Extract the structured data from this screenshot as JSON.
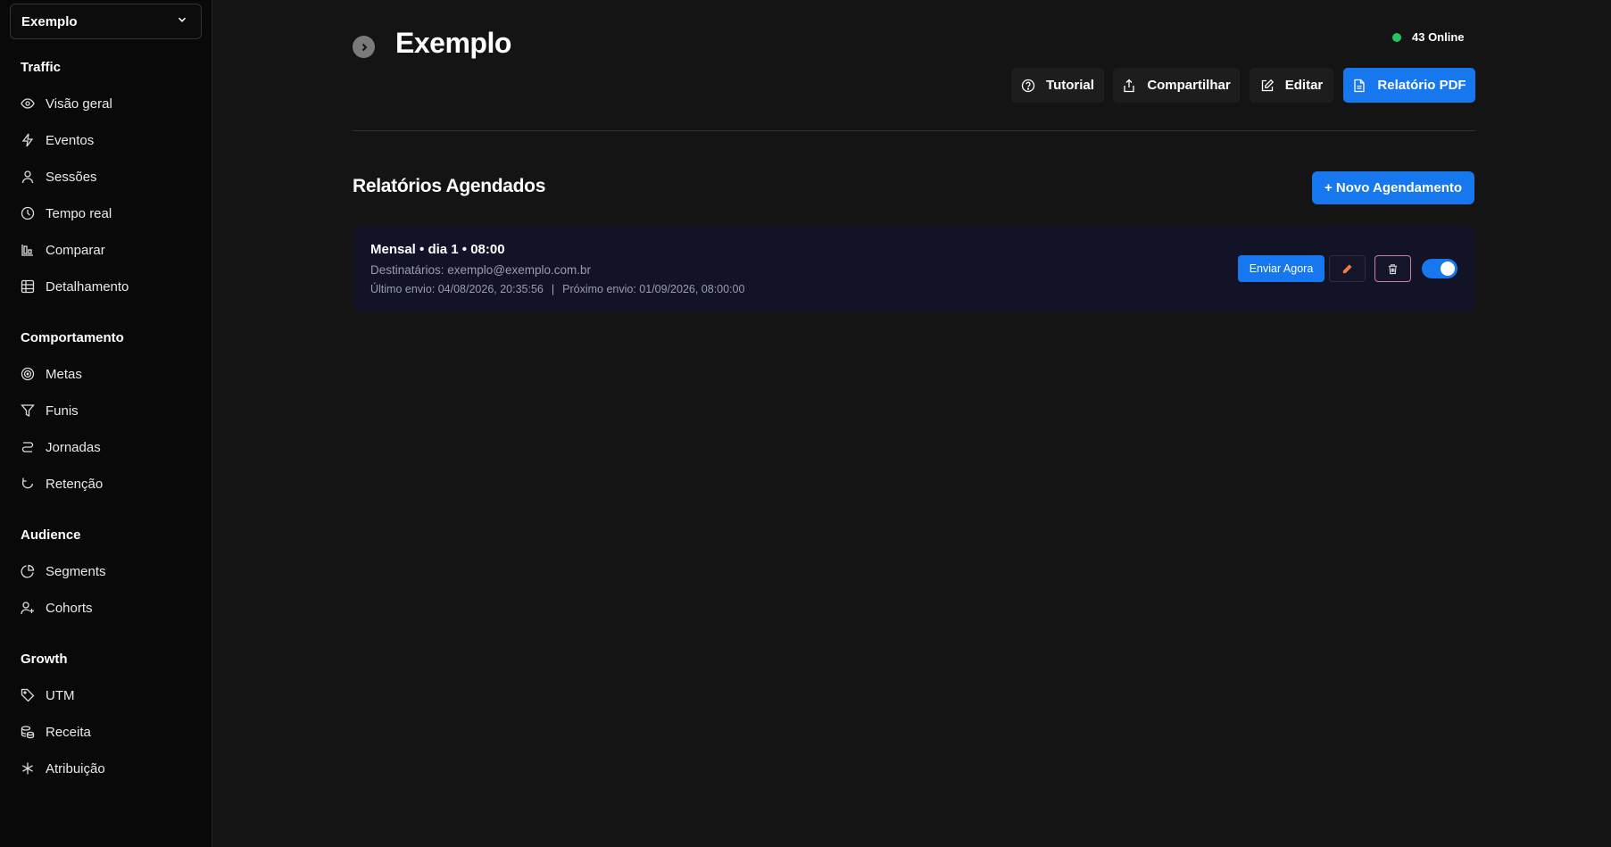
{
  "sidebar": {
    "site_selector": {
      "value": "Exemplo",
      "icon": "chevron-down-icon"
    },
    "groups": [
      {
        "heading": "Traffic",
        "items": [
          {
            "label": "Visão geral",
            "icon": "eye-icon"
          },
          {
            "label": "Eventos",
            "icon": "lightning-icon"
          },
          {
            "label": "Sessões",
            "icon": "user-icon"
          },
          {
            "label": "Tempo real",
            "icon": "clock-icon"
          },
          {
            "label": "Comparar",
            "icon": "bar-chart-icon"
          },
          {
            "label": "Detalhamento",
            "icon": "table-icon"
          }
        ]
      },
      {
        "heading": "Comportamento",
        "items": [
          {
            "label": "Metas",
            "icon": "target-icon"
          },
          {
            "label": "Funis",
            "icon": "funnel-icon"
          },
          {
            "label": "Jornadas",
            "icon": "route-icon"
          },
          {
            "label": "Retenção",
            "icon": "refresh-icon"
          }
        ]
      },
      {
        "heading": "Audience",
        "items": [
          {
            "label": "Segments",
            "icon": "pie-chart-icon"
          },
          {
            "label": "Cohorts",
            "icon": "user-plus-icon"
          }
        ]
      },
      {
        "heading": "Growth",
        "items": [
          {
            "label": "UTM",
            "icon": "tag-icon"
          },
          {
            "label": "Receita",
            "icon": "coins-icon"
          },
          {
            "label": "Atribuição",
            "icon": "asterisk-icon"
          }
        ]
      }
    ]
  },
  "header": {
    "title": "Exemplo",
    "online_text": "43 Online",
    "buttons": {
      "tutorial": "Tutorial",
      "share": "Compartilhar",
      "edit": "Editar",
      "pdf": "Relatório PDF"
    }
  },
  "scheduled": {
    "title": "Relatórios Agendados",
    "new_button": "+ Novo Agendamento",
    "items": [
      {
        "title": "Mensal • dia 1 • 08:00",
        "recipients": "Destinatários: exemplo@exemplo.com.br",
        "last_sent": "Último envio: 04/08/2026, 20:35:56",
        "separator": "|",
        "next_sent": "Próximo envio: 01/09/2026, 08:00:00",
        "send_now": "Enviar Agora",
        "enabled": true
      }
    ]
  },
  "colors": {
    "accent": "#1677ee",
    "online": "#22c55e",
    "edit_icon": "#f07a45",
    "delete_border": "#c8839a"
  }
}
